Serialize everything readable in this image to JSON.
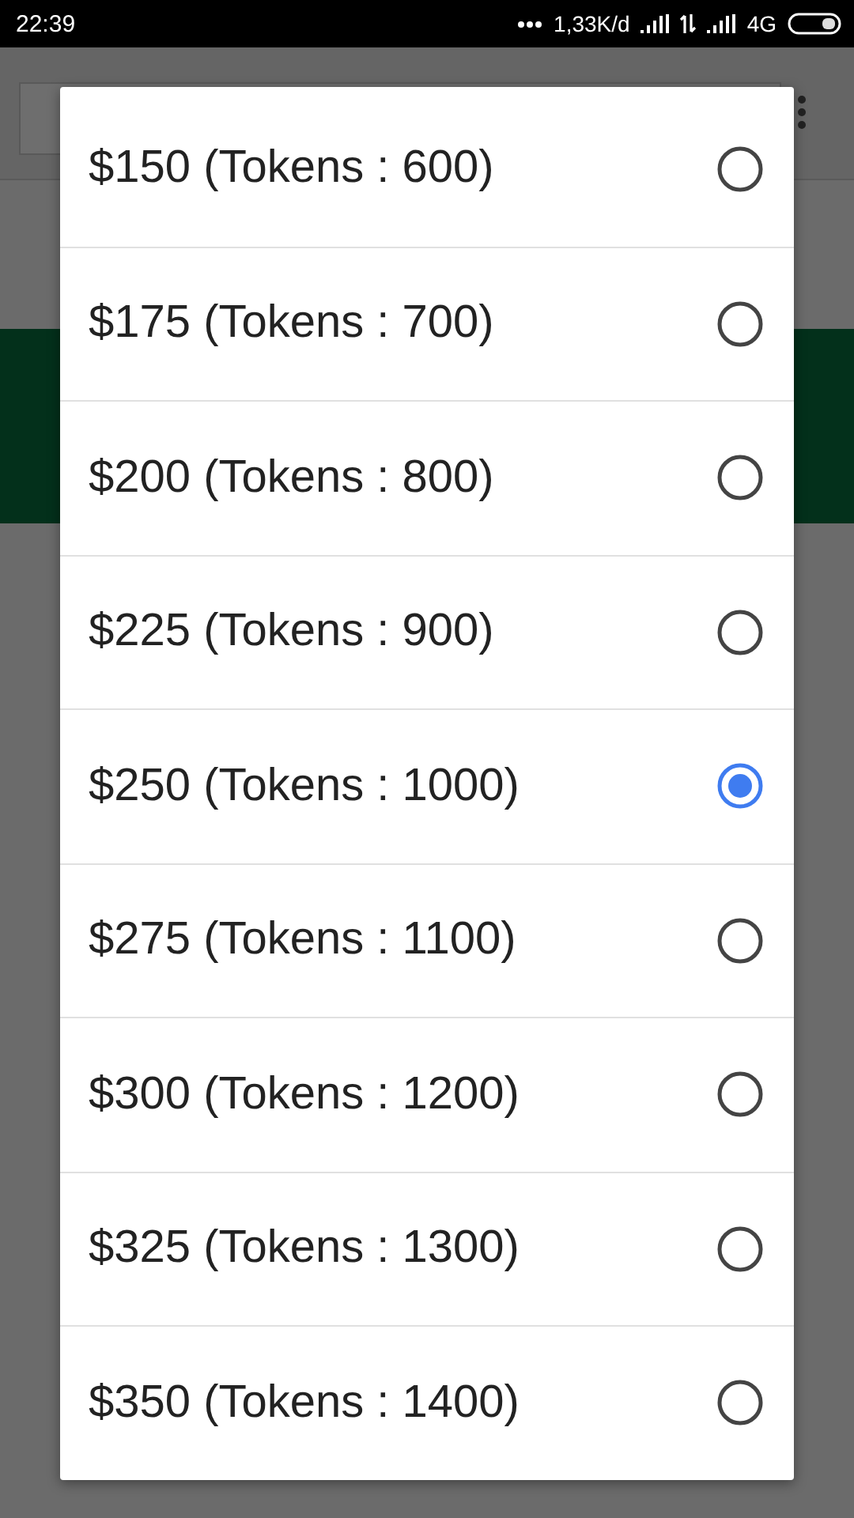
{
  "status_bar": {
    "time": "22:39",
    "speed": "1,33K/d",
    "network": "4G"
  },
  "options": [
    {
      "label": "$150 (Tokens : 600)",
      "selected": false
    },
    {
      "label": "$175 (Tokens : 700)",
      "selected": false
    },
    {
      "label": "$200 (Tokens : 800)",
      "selected": false
    },
    {
      "label": "$225 (Tokens : 900)",
      "selected": false
    },
    {
      "label": "$250 (Tokens : 1000)",
      "selected": true
    },
    {
      "label": "$275 (Tokens : 1100)",
      "selected": false
    },
    {
      "label": "$300 (Tokens : 1200)",
      "selected": false
    },
    {
      "label": "$325 (Tokens : 1300)",
      "selected": false
    },
    {
      "label": "$350 (Tokens : 1400)",
      "selected": false
    }
  ]
}
